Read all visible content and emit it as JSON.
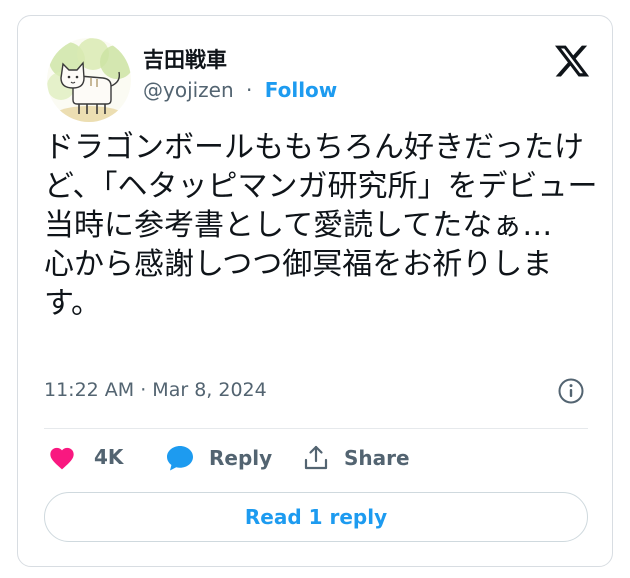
{
  "author": {
    "display_name": "吉田戦車",
    "handle": "@yojizen",
    "separator": "·",
    "follow_label": "Follow",
    "avatar_description": "drawing of a cat"
  },
  "brand": {
    "logo": "x-logo-icon"
  },
  "tweet": {
    "text": "ドラゴンボールももちろん好きだったけど、「ヘタッピマンガ研究所」をデビュー当時に参考書として愛読してたなぁ…\n心から感謝しつつ御冥福をお祈りします。",
    "timestamp": "11:22 AM · Mar 8, 2024"
  },
  "actions": {
    "like_count": "4K",
    "reply_label": "Reply",
    "share_label": "Share"
  },
  "read_replies_label": "Read 1 reply",
  "colors": {
    "accent": "#1d9bf0",
    "like": "#f91880",
    "text": "#0f1419",
    "secondary": "#536471"
  }
}
